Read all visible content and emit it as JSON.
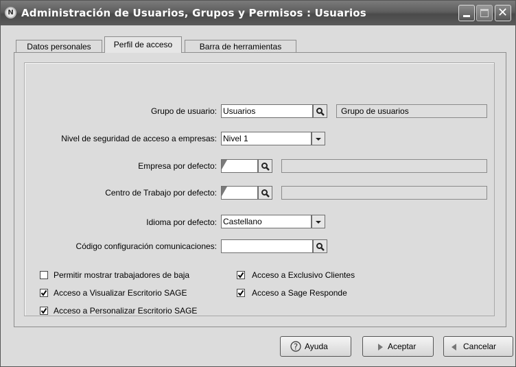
{
  "window": {
    "title": "Administración de Usuarios, Grupos y Permisos : Usuarios",
    "app_icon": "N"
  },
  "tabs": [
    {
      "label": "Datos personales",
      "active": false
    },
    {
      "label": "Perfil de acceso",
      "active": true
    },
    {
      "label": "Barra de herramientas",
      "active": false
    }
  ],
  "form": {
    "grupo_label": "Grupo de usuario:",
    "grupo_value": "Usuarios",
    "grupo_desc": "Grupo de usuarios",
    "nivel_label": "Nivel de seguridad de acceso a empresas:",
    "nivel_value": "Nivel 1",
    "empresa_label": "Empresa por defecto:",
    "empresa_value": "",
    "empresa_desc": "",
    "centro_label": "Centro de Trabajo por defecto:",
    "centro_value": "",
    "centro_desc": "",
    "idioma_label": "Idioma por defecto:",
    "idioma_value": "Castellano",
    "codigo_label": "Código configuración comunicaciones:",
    "codigo_value": ""
  },
  "checkboxes": [
    {
      "label": "Permitir mostrar trabajadores de baja",
      "checked": false
    },
    {
      "label": "Acceso a Exclusivo Clientes",
      "checked": true
    },
    {
      "label": "Acceso a Visualizar Escritorio SAGE",
      "checked": true
    },
    {
      "label": "Acceso a Sage Responde",
      "checked": true
    },
    {
      "label": "Acceso a Personalizar Escritorio SAGE",
      "checked": true
    }
  ],
  "buttons": {
    "ayuda": "Ayuda",
    "aceptar": "Aceptar",
    "cancelar": "Cancelar"
  },
  "icons": {
    "search": "magnifier-icon",
    "help": "help-icon",
    "accept": "triangle-right-icon",
    "cancel": "triangle-left-icon"
  }
}
